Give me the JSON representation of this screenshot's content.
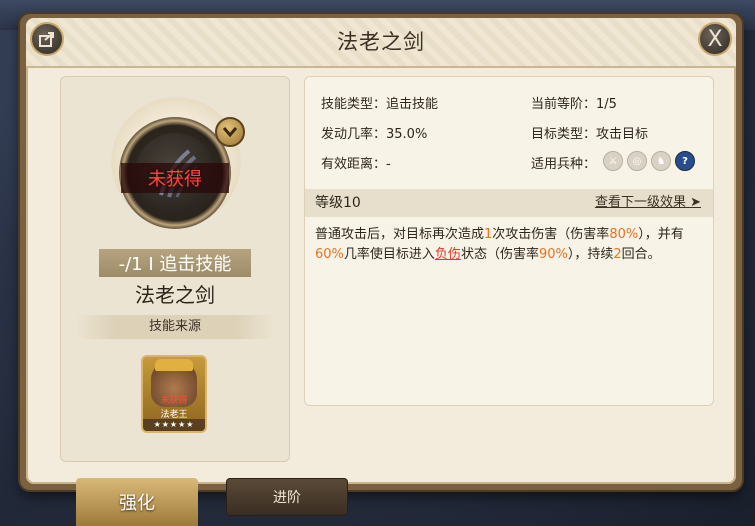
{
  "window": {
    "title": "法老之剑",
    "share_icon": "share-icon",
    "close_icon": "close-icon",
    "close_label": "X"
  },
  "skill": {
    "status": "未获得",
    "type_label": "-/1 I 追击技能",
    "name": "法老之剑",
    "source_label": "技能来源"
  },
  "hero": {
    "status": "未获得",
    "name": "法老王",
    "stars": "★★★★★"
  },
  "stats": {
    "skill_type": "技能类型：追击技能",
    "current_tier": "当前等阶：1/5",
    "trigger_rate": "发动几率：35.0%",
    "target_type": "目标类型：攻击目标",
    "effective_range": "有效距离：-",
    "applicable_units": "适用兵种：",
    "unit_icons": [
      "sword-icon",
      "target-icon",
      "horse-icon",
      "question-icon"
    ]
  },
  "level": {
    "label": "等级10",
    "next_link": "查看下一级效果"
  },
  "description": {
    "p1": "普通攻击后，对目标再次造成",
    "n1": "1",
    "p2": "次攻击伤害（伤害率",
    "n2": "80%",
    "p3": "），并有",
    "n3": "60%",
    "p4": "几率使目标进入",
    "n4": "负伤",
    "p5": "状态（伤害率",
    "n5": "90%",
    "p6": "），持续",
    "n6": "2",
    "p7": "回合。"
  },
  "tabs": {
    "strengthen": "强化",
    "advance": "进阶"
  },
  "colors": {
    "highlight": "#e67320",
    "status_red": "#ff4a3a",
    "panel_bg": "#f3ecdd"
  }
}
